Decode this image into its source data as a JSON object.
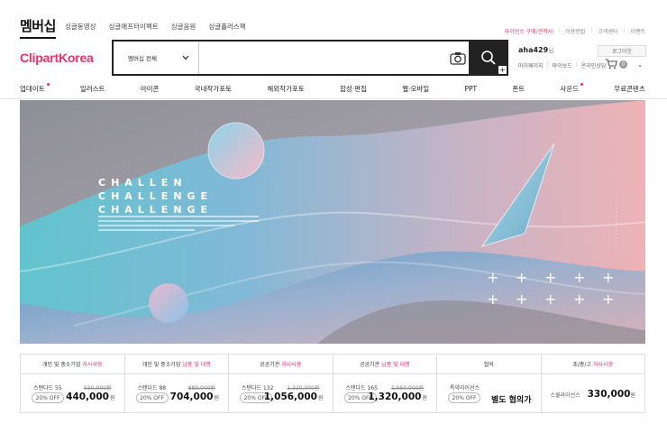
{
  "top": {
    "brand_tab": "멤버십",
    "nav": [
      "싱글동영상",
      "싱글에프터이펙트",
      "싱글음원",
      "싱글플러스팩"
    ],
    "util_links": [
      {
        "label": "라이선스 구매/견적서",
        "highlight": true
      },
      {
        "label": "이용방법",
        "highlight": false
      },
      {
        "label": "고객센터",
        "highlight": false
      },
      {
        "label": "이벤트",
        "highlight": false
      }
    ]
  },
  "logo": "ClipartKorea",
  "search": {
    "scope": "멤버십 전체",
    "value": "",
    "placeholder": ""
  },
  "user": {
    "name": "aha429",
    "suffix": "님",
    "logout": "로그아웃",
    "links": [
      "마이페이지",
      "마이보드",
      "온라인상담"
    ],
    "cart_count": "0"
  },
  "categories": [
    {
      "label": "업데이트",
      "dot": true
    },
    {
      "label": "일러스트",
      "dot": false
    },
    {
      "label": "아이콘",
      "dot": false
    },
    {
      "label": "국내작가포토",
      "dot": false
    },
    {
      "label": "해외작가포토",
      "dot": false
    },
    {
      "label": "합성·편집",
      "dot": false
    },
    {
      "label": "웹·모바일",
      "dot": false
    },
    {
      "label": "PPT",
      "dot": false
    },
    {
      "label": "폰트",
      "dot": false
    },
    {
      "label": "사운드",
      "dot": true
    },
    {
      "label": "무료콘텐츠",
      "dot": false
    }
  ],
  "banner": {
    "lines": [
      "CHALLEN",
      "CHALLENGE",
      "CHALLENGE"
    ]
  },
  "pricing": [
    {
      "head": "개인 및 중소기업",
      "head_hl": "자사사용",
      "license": "스탠다드 55",
      "discount": "20% OFF",
      "old": "550,000원",
      "price": "440,000",
      "unit": "원"
    },
    {
      "head": "개인 및 중소기업",
      "head_hl": "납품 및 대행",
      "license": "스탠다드 88",
      "discount": "20% OFF",
      "old": "880,000원",
      "price": "704,000",
      "unit": "원"
    },
    {
      "head": "공공기관",
      "head_hl": "자사사용",
      "license": "스탠다드 132",
      "discount": "20% OFF",
      "old": "1,320,000원",
      "price": "1,056,000",
      "unit": "원"
    },
    {
      "head": "공공기관",
      "head_hl": "납품 및 대행",
      "license": "스탠다드 165",
      "discount": "20% OFF",
      "old": "1,650,000원",
      "price": "1,320,000",
      "unit": "원"
    },
    {
      "head": "협의",
      "head_hl": "",
      "license": "특약라이선스",
      "discount": "20% OFF",
      "old": "",
      "price": "별도 협의가",
      "unit": ""
    },
    {
      "head": "초/중/고",
      "head_hl": "자사사용",
      "license": "스쿨라이선스",
      "discount": "",
      "old": "",
      "price": "330,000",
      "unit": "원"
    }
  ]
}
